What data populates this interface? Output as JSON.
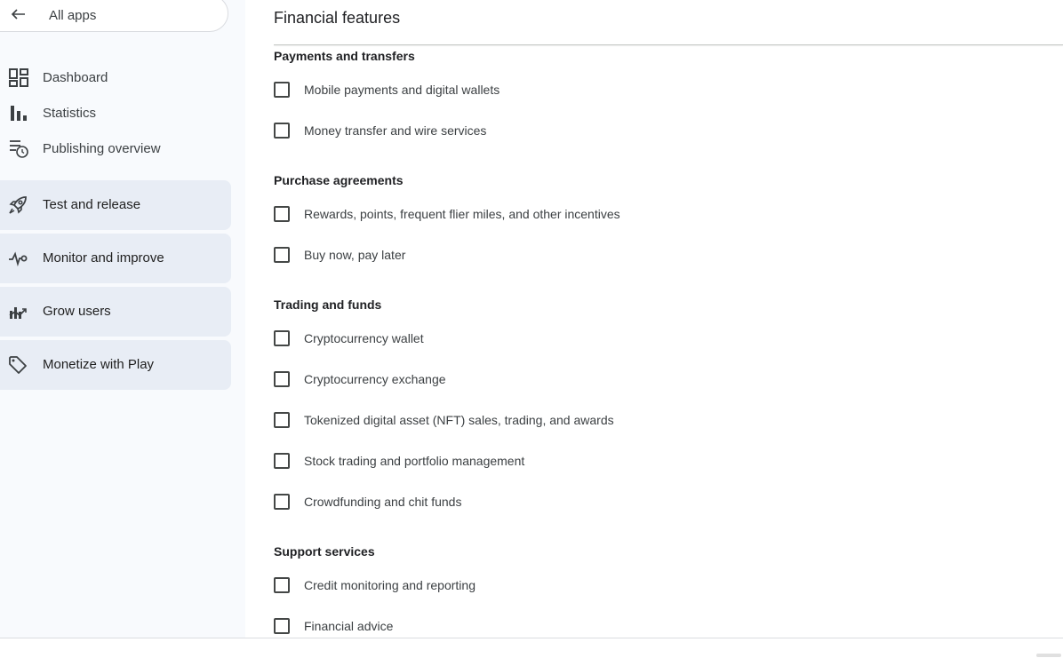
{
  "sidebar": {
    "all_apps": "All apps",
    "items": [
      {
        "label": "Dashboard",
        "icon": "dashboard-icon"
      },
      {
        "label": "Statistics",
        "icon": "bar-chart-icon"
      },
      {
        "label": "Publishing overview",
        "icon": "publishing-overview-icon"
      }
    ],
    "groups": [
      {
        "label": "Test and release",
        "icon": "rocket-icon"
      },
      {
        "label": "Monitor and improve",
        "icon": "vitals-icon"
      },
      {
        "label": "Grow users",
        "icon": "grow-chart-icon"
      },
      {
        "label": "Monetize with Play",
        "icon": "tag-icon"
      }
    ]
  },
  "main": {
    "title": "Financial features",
    "sections": [
      {
        "title": "Payments and transfers",
        "options": [
          "Mobile payments and digital wallets",
          "Money transfer and wire services"
        ]
      },
      {
        "title": "Purchase agreements",
        "options": [
          "Rewards, points, frequent flier miles, and other incentives",
          "Buy now, pay later"
        ]
      },
      {
        "title": "Trading and funds",
        "options": [
          "Cryptocurrency wallet",
          "Cryptocurrency exchange",
          "Tokenized digital asset (NFT) sales, trading, and awards",
          "Stock trading and portfolio management",
          "Crowdfunding and chit funds"
        ]
      },
      {
        "title": "Support services",
        "options": [
          "Credit monitoring and reporting",
          "Financial advice"
        ]
      }
    ]
  },
  "colors": {
    "sidebar_bg": "#f8fafd",
    "group_bg": "#e8edf5",
    "text": "#202124",
    "checkbox_border": "#444746"
  }
}
